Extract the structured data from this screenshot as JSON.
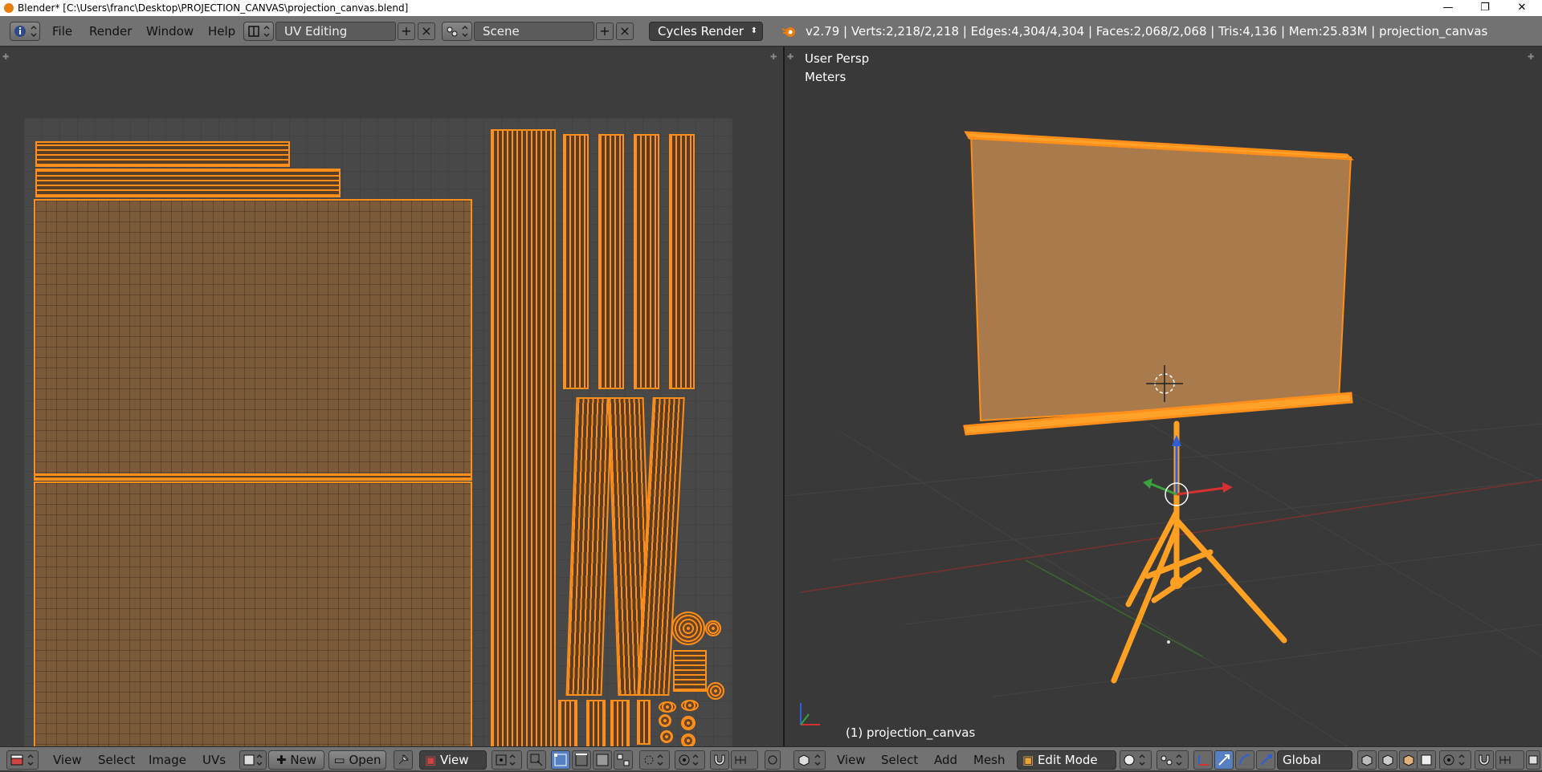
{
  "window": {
    "title": "Blender* [C:\\Users\\franc\\Desktop\\PROJECTION_CANVAS\\projection_canvas.blend]",
    "minimize": "—",
    "maximize": "❐",
    "close": "✕"
  },
  "info_bar": {
    "menus": [
      "File",
      "Render",
      "Window",
      "Help"
    ],
    "screen_layout": "UV Editing",
    "scene": "Scene",
    "render_engine": "Cycles Render",
    "stats": "v2.79 | Verts:2,218/2,218 | Edges:4,304/4,304 | Faces:2,068/2,068 | Tris:4,136 | Mem:25.83M | projection_canvas"
  },
  "viewport": {
    "view_name": "User Persp",
    "units": "Meters",
    "object_label": "(1) projection_canvas"
  },
  "uv_footer": {
    "menus": [
      "View",
      "Select",
      "Image",
      "UVs"
    ],
    "new_label": "New",
    "open_label": "Open",
    "view_label": "View"
  },
  "vp_footer": {
    "menus": [
      "View",
      "Select",
      "Add",
      "Mesh"
    ],
    "mode": "Edit Mode",
    "orientation": "Global"
  },
  "colors": {
    "selection": "#ff8f1a",
    "uv_face": "#7b5a3a",
    "canvas_face": "#a97a4c",
    "header": "#727272",
    "background": "#393939"
  }
}
